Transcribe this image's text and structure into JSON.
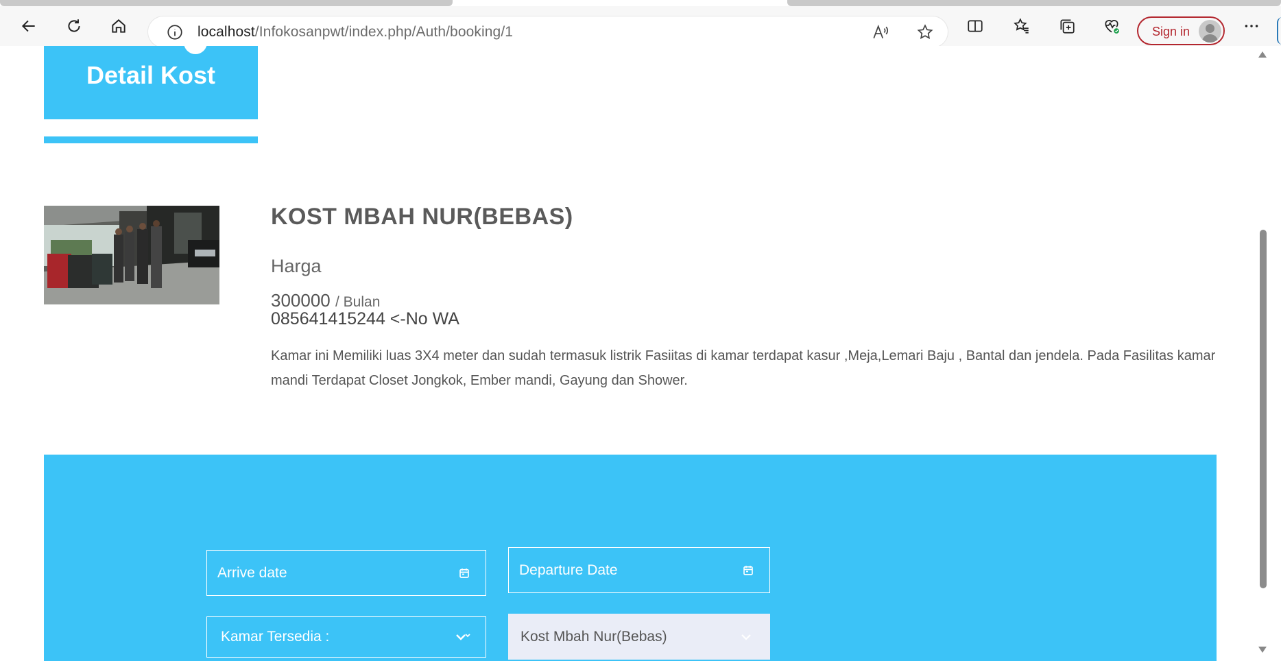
{
  "browser": {
    "url_host": "localhost",
    "url_path": "/Infokosanpwt/index.php/Auth/booking/1",
    "signin_label": "Sign in",
    "icons": [
      "back-icon",
      "refresh-icon",
      "home-icon",
      "info-icon",
      "read-aloud-icon",
      "favorite-star-icon",
      "split-screen-icon",
      "favorites-icon",
      "collections-icon",
      "browser-health-icon",
      "more-icon"
    ]
  },
  "header": {
    "title": "Detail Kost"
  },
  "kost": {
    "name": "KOST MBAH NUR(BEBAS)",
    "price_label": "Harga",
    "price": "300000",
    "price_unit": "/ Bulan",
    "phone": "085641415244 <-No WA",
    "description": "Kamar ini Memiliki luas 3X4 meter dan sudah termasuk listrik Fasiitas di kamar terdapat kasur ,Meja,Lemari Baju , Bantal dan jendela. Pada Fasilitas kamar mandi Terdapat Closet Jongkok, Ember mandi, Gayung dan Shower."
  },
  "booking": {
    "arrive_placeholder": "Arrive date",
    "departure_placeholder": "Departure Date",
    "room_select": "Kamar Tersedia :",
    "kost_select": "Kost Mbah Nur(Bebas)"
  },
  "colors": {
    "accent": "#3cc3f7",
    "signin": "#b3262e",
    "select_bg": "#eaedf7"
  }
}
